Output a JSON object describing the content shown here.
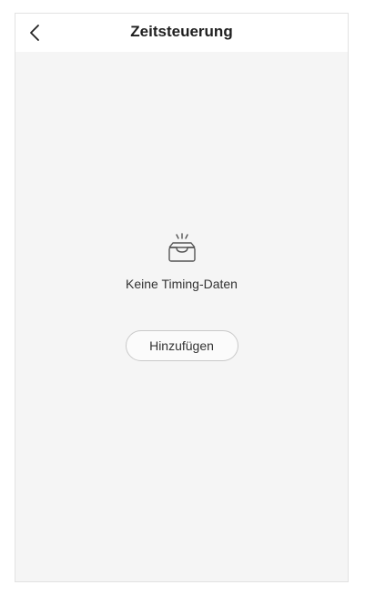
{
  "header": {
    "title": "Zeitsteuerung",
    "back_icon": "chevron-left-icon"
  },
  "empty_state": {
    "icon": "empty-inbox-icon",
    "message": "Keine Timing-Daten",
    "add_button_label": "Hinzufügen"
  },
  "colors": {
    "background": "#f5f5f5",
    "header_background": "#ffffff",
    "text": "#333333",
    "button_border": "#c9c9c9"
  }
}
